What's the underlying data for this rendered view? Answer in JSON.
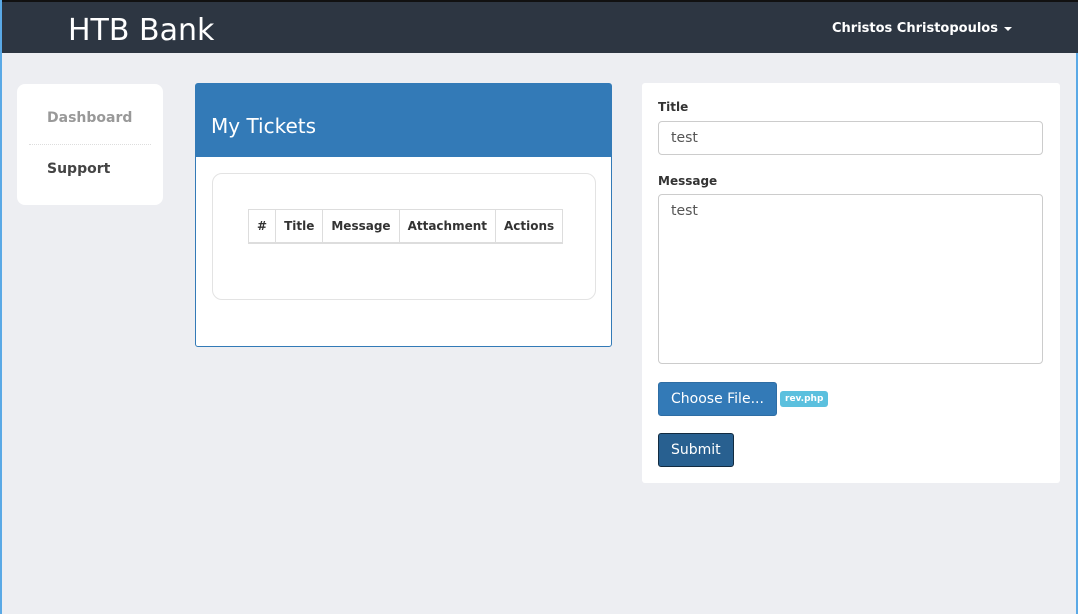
{
  "navbar": {
    "brand": "HTB Bank",
    "user": "Christos Christopoulos"
  },
  "sidebar": {
    "items": [
      {
        "label": "Dashboard"
      },
      {
        "label": "Support"
      }
    ]
  },
  "tickets": {
    "title": "My Tickets",
    "columns": [
      "#",
      "Title",
      "Message",
      "Attachment",
      "Actions"
    ]
  },
  "form": {
    "title_label": "Title",
    "title_value": "test",
    "message_label": "Message",
    "message_value": "test",
    "choose_file": "Choose File...",
    "file_name": "rev.php",
    "submit": "Submit"
  }
}
